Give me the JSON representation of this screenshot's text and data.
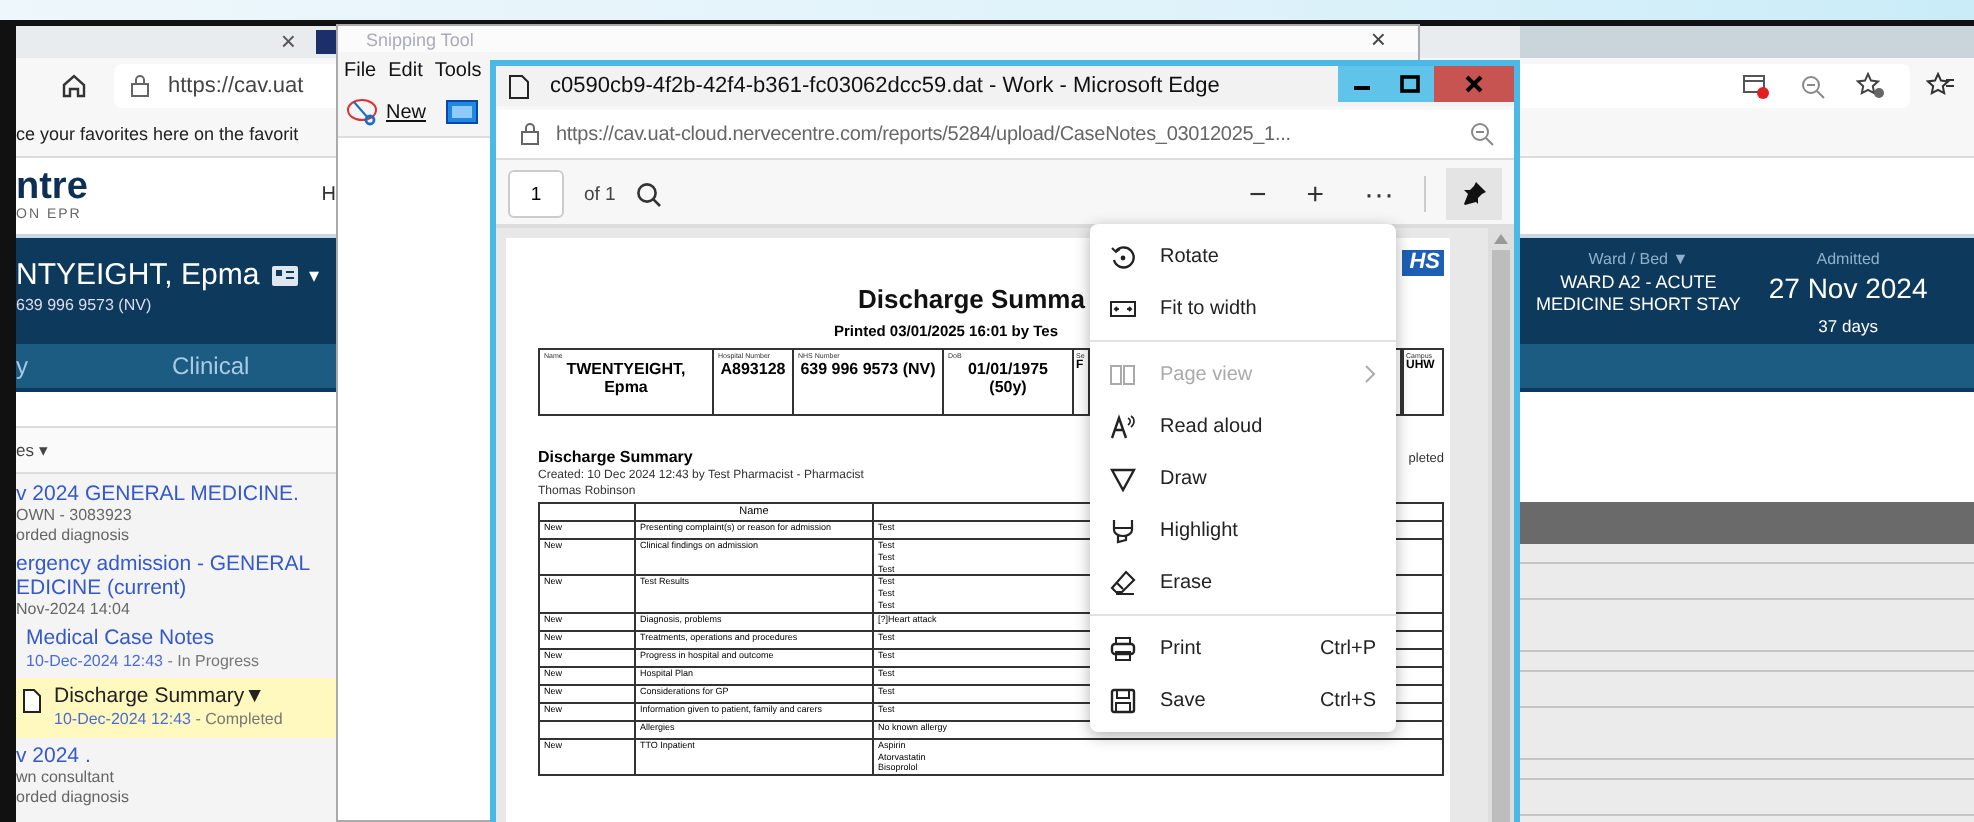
{
  "background_browser": {
    "tab_close": "×",
    "address": "https://cav.uat",
    "favorites_hint": "ce your favorites here on the favorit",
    "logo": {
      "name": "ntre",
      "subtitle": "ON EPR"
    },
    "header_link": "H",
    "patient": {
      "name": "NTYEIGHT, Epma",
      "caret": "▾",
      "number": "639 996 9573 (NV)"
    },
    "ward": {
      "label": "Ward / Bed ▼",
      "value_lines": [
        "WARD A2 - ACUTE",
        "MEDICINE SHORT STAY"
      ]
    },
    "admitted": {
      "label": "Admitted",
      "date": "27 Nov 2024",
      "days": "37 days"
    },
    "tabs": [
      {
        "label": "y",
        "selected": false
      },
      {
        "label": "Clinical",
        "selected": false
      }
    ],
    "list_header": "es ▾",
    "entries": [
      {
        "kind": "episode",
        "selected": false,
        "title_lines": [
          "v 2024 GENERAL MEDICINE."
        ],
        "details": [
          "OWN - 3083923",
          "orded diagnosis"
        ]
      },
      {
        "kind": "episode",
        "selected": false,
        "title_lines": [
          "ergency admission - GENERAL",
          "EDICINE (current)"
        ],
        "details": [
          "Nov-2024 14:04"
        ]
      },
      {
        "kind": "note",
        "selected": false,
        "title_lines": [
          "Medical Case Notes"
        ],
        "date": "10-Dec-2024 12:43",
        "status": "- In Progress"
      },
      {
        "kind": "document",
        "selected": true,
        "title_lines": [
          "Discharge Summary"
        ],
        "caret": "▼",
        "date": "10-Dec-2024 12:43",
        "status": "- Completed"
      },
      {
        "kind": "episode",
        "selected": false,
        "title_lines": [
          "v 2024 ."
        ],
        "details": [
          "wn consultant",
          "orded diagnosis"
        ]
      }
    ]
  },
  "snipping_tool": {
    "title": "Snipping Tool",
    "close": "×",
    "menu": [
      "File",
      "Edit",
      "Tools"
    ],
    "new_button": "New"
  },
  "pdf_window": {
    "title": "c0590cb9-4f2b-42f4-b361-fc03062dcc59.dat - Work - Microsoft Edge",
    "address": "https://cav.uat-cloud.nervecentre.com/reports/5284/upload/CaseNotes_03012025_1...",
    "page": "1",
    "page_count": "of 1",
    "zoom_out": "−",
    "zoom_in": "+",
    "more": "···",
    "document": {
      "nhs_logo": "HS",
      "title": "Discharge Summa",
      "printed": "Printed 03/01/2025 16:01 by Tes",
      "patient_table": [
        {
          "label": "Name",
          "value": "TWENTYEIGHT, Epma"
        },
        {
          "label": "Hospital Number",
          "value": "A893128"
        },
        {
          "label": "NHS Number",
          "value": "639 996 9573 (NV)"
        },
        {
          "label": "DoB",
          "value": "01/01/1975 (50y)"
        },
        {
          "label": "Se",
          "value": "F"
        }
      ],
      "campus": {
        "label": "Campus",
        "value": "UHW"
      },
      "section_title": "Discharge Summary",
      "status_fragment": "pleted",
      "created": "Created: 10 Dec 2024 12:43 by Test Pharmacist - Pharmacist",
      "author": "Thomas Robinson",
      "table": {
        "name_header": "Name",
        "rows": [
          {
            "status": "New",
            "name": "Presenting complaint(s) or reason for admission",
            "values": [
              "Test"
            ]
          },
          {
            "status": "New",
            "name": "Clinical findings on admission",
            "values": [
              "Test",
              "Test",
              "Test"
            ]
          },
          {
            "status": "New",
            "name": "Test Results",
            "values": [
              "Test",
              "Test",
              "Test"
            ]
          },
          {
            "status": "New",
            "name": "Diagnosis, problems",
            "values": [
              "[?]Heart attack"
            ]
          },
          {
            "status": "New",
            "name": "Treatments, operations and procedures",
            "values": [
              "Test"
            ]
          },
          {
            "status": "New",
            "name": "Progress in hospital and outcome",
            "values": [
              "Test"
            ]
          },
          {
            "status": "New",
            "name": "Hospital Plan",
            "values": [
              "Test"
            ]
          },
          {
            "status": "New",
            "name": "Considerations for GP",
            "values": [
              "Test"
            ]
          },
          {
            "status": "New",
            "name": "Information given to patient, family and carers",
            "values": [
              "Test"
            ]
          },
          {
            "status": "",
            "name": "Allergies",
            "values": [
              "No known allergy"
            ]
          },
          {
            "status": "New",
            "name": "TTO Inpatient",
            "values": [
              "Aspirin",
              "Atorvastatin",
              "Bisoprolol"
            ]
          }
        ]
      }
    },
    "menu": {
      "groups": [
        [
          {
            "label": "Rotate",
            "disabled": false
          },
          {
            "label": "Fit to width",
            "disabled": false
          }
        ],
        [
          {
            "label": "Page view",
            "disabled": true,
            "submenu": true
          },
          {
            "label": "Read aloud",
            "disabled": false
          },
          {
            "label": "Draw",
            "disabled": false
          },
          {
            "label": "Highlight",
            "disabled": false
          },
          {
            "label": "Erase",
            "disabled": false
          }
        ],
        [
          {
            "label": "Print",
            "shortcut": "Ctrl+P",
            "disabled": false
          },
          {
            "label": "Save",
            "shortcut": "Ctrl+S",
            "disabled": false
          }
        ]
      ]
    }
  }
}
